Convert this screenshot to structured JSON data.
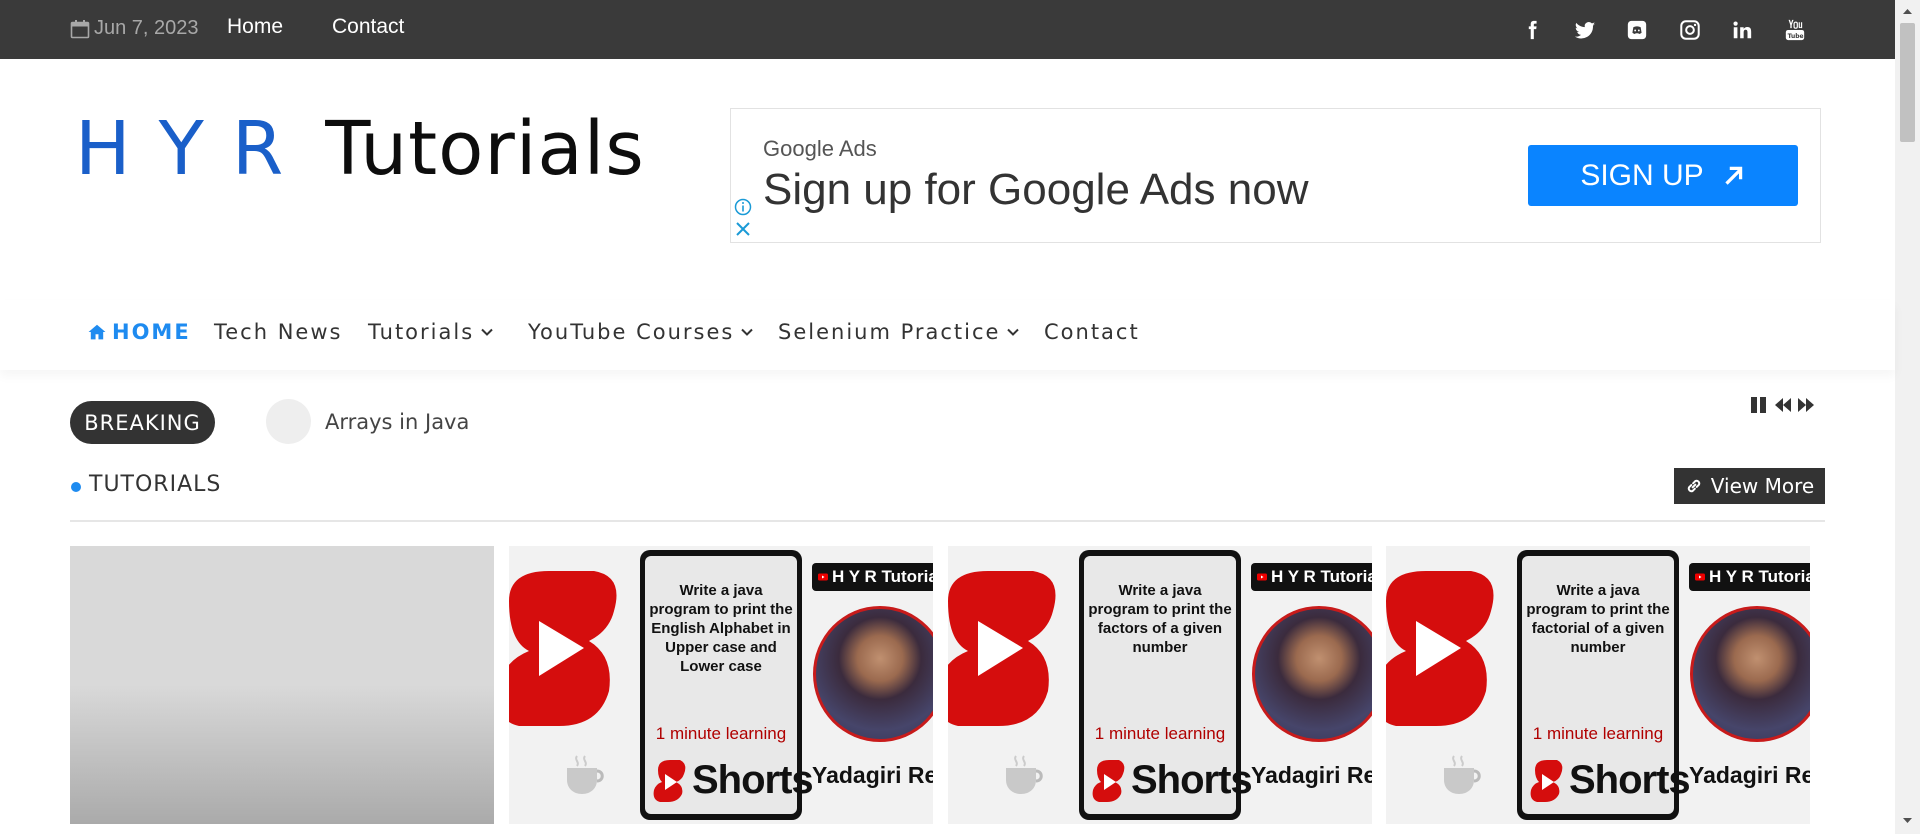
{
  "topbar": {
    "date": "Jun 7, 2023",
    "links": [
      "Home",
      "Contact"
    ],
    "social": [
      "facebook-icon",
      "twitter-icon",
      "discord-icon",
      "instagram-icon",
      "linkedin-icon",
      "youtube-icon"
    ]
  },
  "logo": {
    "hyr": "HYR",
    "rest": "Tutorials"
  },
  "ad": {
    "small": "Google Ads",
    "title": "Sign up for Google Ads now",
    "button": "SIGN UP"
  },
  "nav": {
    "home": "HOME",
    "items": [
      "Tech News",
      "Tutorials",
      "YouTube Courses",
      "Selenium Practice",
      "Contact"
    ]
  },
  "breaking": {
    "label": "BREAKING",
    "headline": "Arrays in Java"
  },
  "section": {
    "title": "TUTORIALS",
    "view_more": "View More"
  },
  "cards": [
    {
      "text": "Write a java program to print the English Alphabet in Upper case and Lower case",
      "learning": "1 minute learning",
      "shorts": "Shorts",
      "brand": "H Y R Tutorials",
      "name": "Yadagiri Reddy"
    },
    {
      "text": "Write a java program to print the factors of a given number",
      "learning": "1 minute learning",
      "shorts": "Shorts",
      "brand": "H Y R Tutorials",
      "name": "Yadagiri Reddy"
    },
    {
      "text": "Write a java program to print the factorial of a given number",
      "learning": "1 minute learning",
      "shorts": "Shorts",
      "brand": "H Y R Tutorials",
      "name": "Yadagiri Reddy"
    }
  ],
  "colors": {
    "accent": "#1e8bf0",
    "topbar": "#3a3a3a",
    "ad_button": "#0a84ff",
    "shorts_red": "#d00000"
  }
}
